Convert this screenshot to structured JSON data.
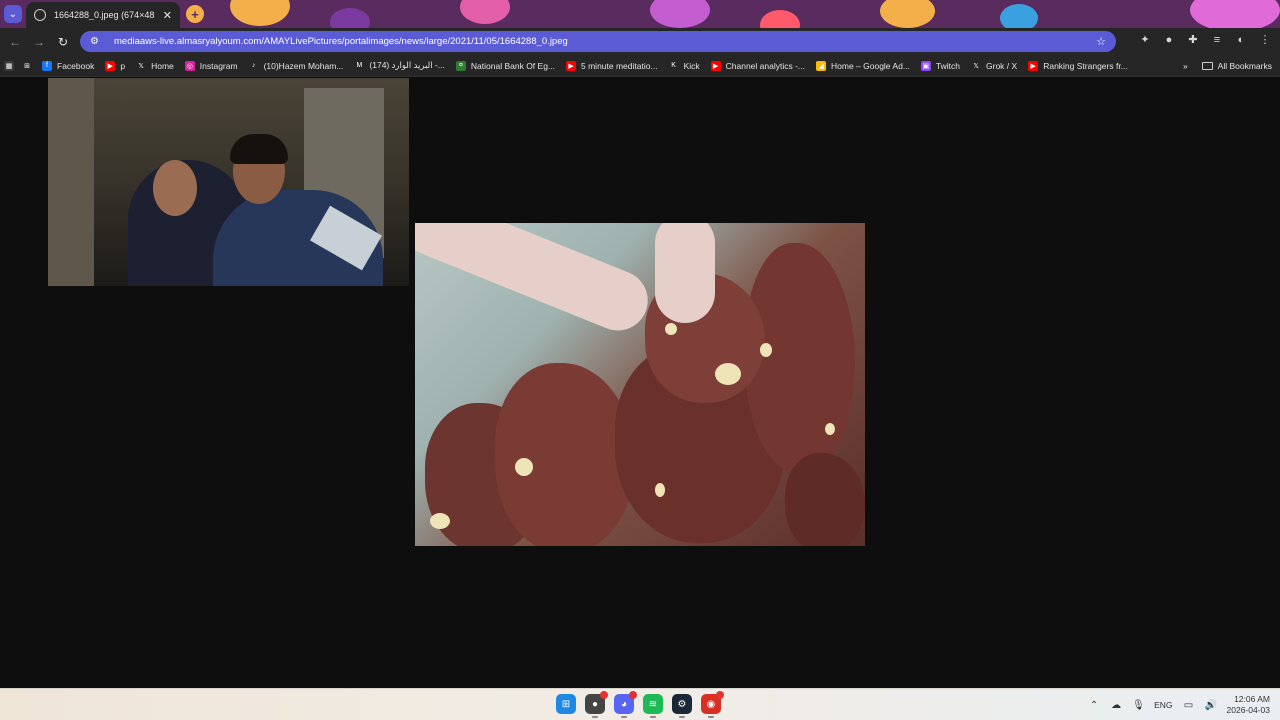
{
  "browser": {
    "tab_title": "1664288_0.jpeg (674×485)",
    "tab_close": "✕",
    "new_tab": "+",
    "url": "mediaaws-live.almasryalyoum.com/AMAYLivePictures/portalimages/news/large/2021/11/05/1664288_0.jpeg"
  },
  "toolbar": {
    "back": "←",
    "forward": "→",
    "reload": "↻",
    "star": "☆"
  },
  "bookmarks": {
    "items": [
      {
        "label": "Facebook",
        "icon": "facebook-icon",
        "color": "#1877f2",
        "glyph": "f"
      },
      {
        "label": "p",
        "icon": "youtube-icon",
        "color": "#ff0000",
        "glyph": "▶"
      },
      {
        "label": "Home",
        "icon": "x-icon",
        "color": "#262626",
        "glyph": "𝕏"
      },
      {
        "label": "Instagram",
        "icon": "instagram-icon",
        "color": "#d6249f",
        "glyph": "◎"
      },
      {
        "label": "(10)Hazem Moham...",
        "icon": "tiktok-icon",
        "color": "#262626",
        "glyph": "♪"
      },
      {
        "label": "(174) البريد الوارد -...",
        "icon": "gmail-icon",
        "color": "#262626",
        "glyph": "M"
      },
      {
        "label": "National Bank Of Eg...",
        "icon": "bank-icon",
        "color": "#2e7d32",
        "glyph": "¤"
      },
      {
        "label": "5 minute meditatio...",
        "icon": "youtube-icon",
        "color": "#ff0000",
        "glyph": "▶"
      },
      {
        "label": "Kick",
        "icon": "kick-icon",
        "color": "#262626",
        "glyph": "K"
      },
      {
        "label": "Channel analytics -...",
        "icon": "youtube-icon",
        "color": "#ff0000",
        "glyph": "▶"
      },
      {
        "label": "Home – Google Ad...",
        "icon": "google-ads-icon",
        "color": "#fbbc04",
        "glyph": "◢"
      },
      {
        "label": "Twitch",
        "icon": "twitch-icon",
        "color": "#9146ff",
        "glyph": "▣"
      },
      {
        "label": "Grok / X",
        "icon": "x-icon",
        "color": "#262626",
        "glyph": "𝕏"
      },
      {
        "label": "Ranking Strangers fr...",
        "icon": "youtube-icon",
        "color": "#ff0000",
        "glyph": "▶"
      }
    ],
    "more": "»",
    "all_bookmarks": "All Bookmarks"
  },
  "taskbar": {
    "language": "ENG",
    "time": "12:06 AM",
    "date": "2026-04-03",
    "apps": [
      {
        "name": "start-button",
        "color": "#1e88e5",
        "glyph": "⊞"
      },
      {
        "name": "chrome-app",
        "color": "#444444",
        "glyph": "●",
        "badge": true
      },
      {
        "name": "discord-app",
        "color": "#5865f2",
        "glyph": "◕",
        "badge": true
      },
      {
        "name": "spotify-app",
        "color": "#1db954",
        "glyph": "≋"
      },
      {
        "name": "steam-app",
        "color": "#1b2838",
        "glyph": "⚙"
      },
      {
        "name": "chrome-dev-app",
        "color": "#d93025",
        "glyph": "◉",
        "badge": true
      }
    ]
  },
  "colors": {
    "accent": "#5b5bd6",
    "toolbar_bg": "#262626",
    "page_bg": "#0e0e0e"
  }
}
